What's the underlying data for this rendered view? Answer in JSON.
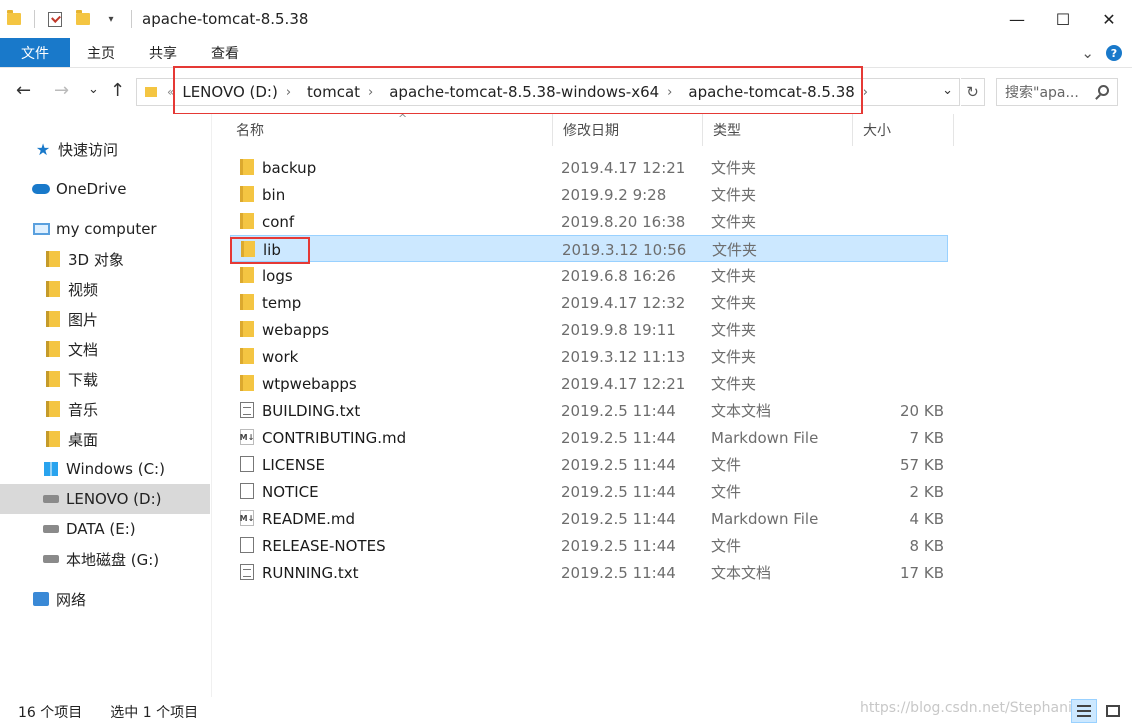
{
  "window": {
    "title": "apache-tomcat-8.5.38",
    "controls": {
      "minimize": "—",
      "maximize": "☐",
      "close": "✕"
    }
  },
  "ribbon": {
    "tabs": [
      "文件",
      "主页",
      "共享",
      "查看"
    ],
    "expand": "⌄",
    "help": "?"
  },
  "nav": {
    "back": "←",
    "forward": "→",
    "recent": "⌄",
    "up": "↑"
  },
  "address": {
    "more": "«",
    "crumbs": [
      "LENOVO (D:)",
      "tomcat",
      "apache-tomcat-8.5.38-windows-x64",
      "apache-tomcat-8.5.38"
    ],
    "separator": "›",
    "dropdown": "⌄",
    "refresh": "↻"
  },
  "search": {
    "placeholder": "搜索\"apa..."
  },
  "sidebar": {
    "items": [
      {
        "label": "快速访问",
        "icon": "star-icon"
      },
      {
        "label": "OneDrive",
        "icon": "cloud-icon"
      },
      {
        "label": "my computer",
        "icon": "pc-icon"
      },
      {
        "label": "3D 对象",
        "icon": "folder-3d-icon"
      },
      {
        "label": "视频",
        "icon": "folder-video-icon"
      },
      {
        "label": "图片",
        "icon": "folder-pictures-icon"
      },
      {
        "label": "文档",
        "icon": "folder-documents-icon"
      },
      {
        "label": "下载",
        "icon": "folder-downloads-icon"
      },
      {
        "label": "音乐",
        "icon": "folder-music-icon"
      },
      {
        "label": "桌面",
        "icon": "folder-desktop-icon"
      },
      {
        "label": "Windows (C:)",
        "icon": "windows-drive-icon"
      },
      {
        "label": "LENOVO (D:)",
        "icon": "drive-icon"
      },
      {
        "label": "DATA (E:)",
        "icon": "drive-icon"
      },
      {
        "label": "本地磁盘 (G:)",
        "icon": "drive-icon"
      },
      {
        "label": "网络",
        "icon": "network-icon"
      }
    ]
  },
  "columns": {
    "name": "名称",
    "modified": "修改日期",
    "type": "类型",
    "size": "大小",
    "sort": "^"
  },
  "files": [
    {
      "name": "backup",
      "date": "2019.4.17 12:21",
      "type": "文件夹",
      "size": "",
      "kind": "folder"
    },
    {
      "name": "bin",
      "date": "2019.9.2 9:28",
      "type": "文件夹",
      "size": "",
      "kind": "folder"
    },
    {
      "name": "conf",
      "date": "2019.8.20 16:38",
      "type": "文件夹",
      "size": "",
      "kind": "folder"
    },
    {
      "name": "lib",
      "date": "2019.3.12 10:56",
      "type": "文件夹",
      "size": "",
      "kind": "folder",
      "selected": true
    },
    {
      "name": "logs",
      "date": "2019.6.8 16:26",
      "type": "文件夹",
      "size": "",
      "kind": "folder"
    },
    {
      "name": "temp",
      "date": "2019.4.17 12:32",
      "type": "文件夹",
      "size": "",
      "kind": "folder"
    },
    {
      "name": "webapps",
      "date": "2019.9.8 19:11",
      "type": "文件夹",
      "size": "",
      "kind": "folder"
    },
    {
      "name": "work",
      "date": "2019.3.12 11:13",
      "type": "文件夹",
      "size": "",
      "kind": "folder"
    },
    {
      "name": "wtpwebapps",
      "date": "2019.4.17 12:21",
      "type": "文件夹",
      "size": "",
      "kind": "folder"
    },
    {
      "name": "BUILDING.txt",
      "date": "2019.2.5 11:44",
      "type": "文本文档",
      "size": "20 KB",
      "kind": "txt"
    },
    {
      "name": "CONTRIBUTING.md",
      "date": "2019.2.5 11:44",
      "type": "Markdown File",
      "size": "7 KB",
      "kind": "md"
    },
    {
      "name": "LICENSE",
      "date": "2019.2.5 11:44",
      "type": "文件",
      "size": "57 KB",
      "kind": "blank"
    },
    {
      "name": "NOTICE",
      "date": "2019.2.5 11:44",
      "type": "文件",
      "size": "2 KB",
      "kind": "blank"
    },
    {
      "name": "README.md",
      "date": "2019.2.5 11:44",
      "type": "Markdown File",
      "size": "4 KB",
      "kind": "md"
    },
    {
      "name": "RELEASE-NOTES",
      "date": "2019.2.5 11:44",
      "type": "文件",
      "size": "8 KB",
      "kind": "blank"
    },
    {
      "name": "RUNNING.txt",
      "date": "2019.2.5 11:44",
      "type": "文本文档",
      "size": "17 KB",
      "kind": "txt"
    }
  ],
  "status": {
    "count": "16 个项目",
    "selection": "选中 1 个项目"
  },
  "watermark": "https://blog.csdn.net/Stephanie..."
}
